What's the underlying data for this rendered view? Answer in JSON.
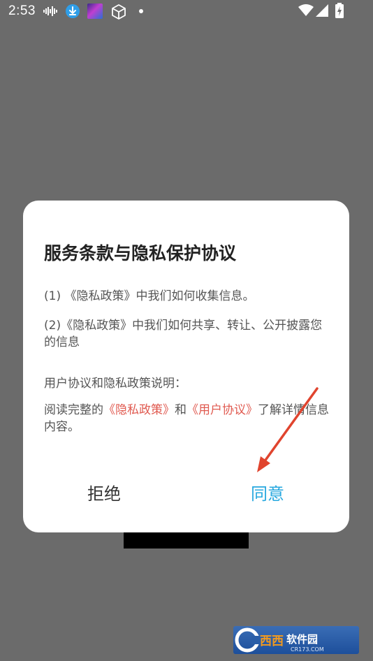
{
  "status_bar": {
    "time": "2:53",
    "icons": [
      "waveform-icon",
      "download-icon",
      "game-app-icon",
      "cube-icon",
      "notification-dot-icon",
      "wifi-icon",
      "signal-icon",
      "battery-charging-icon"
    ]
  },
  "dialog": {
    "title": "服务条款与隐私保护协议",
    "item1": "(1) 《隐私政策》中我们如何收集信息。",
    "item2": "(2)《隐私政策》中我们如何共享、转让、公开披露您的信息",
    "section_heading": "用户协议和隐私政策说明：",
    "read_prefix": "阅读完整的",
    "privacy_link": "《隐私政策》",
    "read_and": "和",
    "user_agreement_link": "《用户协议》",
    "read_suffix": "了解详情信息内容。",
    "reject_label": "拒绝",
    "agree_label": "同意"
  },
  "colors": {
    "backdrop": "#6b6b6b",
    "link": "#e05a50",
    "agree": "#27a8df",
    "annotation_arrow": "#e0442e"
  },
  "watermark": {
    "logo_text": "西西软件园",
    "domain_text": "CR173.COM"
  }
}
